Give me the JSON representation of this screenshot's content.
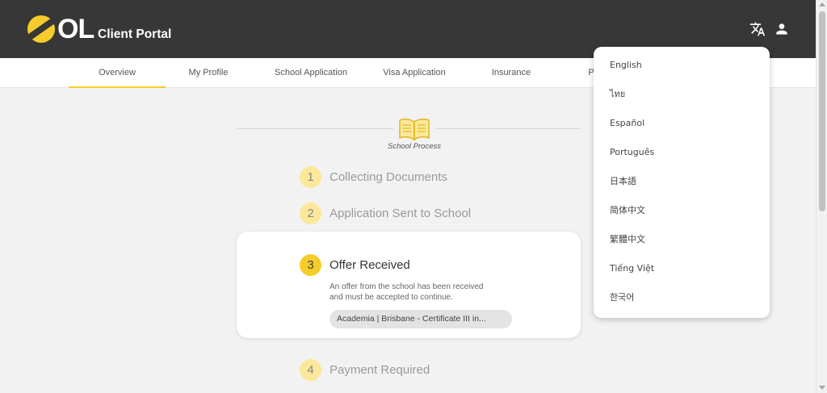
{
  "brand": {
    "logo_text": "OL",
    "portal_title": "Client Portal",
    "accent": "#f5cc2a",
    "header_bg": "#373737"
  },
  "header_icons": [
    "translate-icon",
    "account-icon"
  ],
  "nav": {
    "tabs": [
      {
        "label": "Overview",
        "active": true
      },
      {
        "label": "My Profile",
        "active": false
      },
      {
        "label": "School Application",
        "active": false
      },
      {
        "label": "Visa Application",
        "active": false
      },
      {
        "label": "Insurance",
        "active": false
      },
      {
        "label": "P",
        "active": false
      }
    ]
  },
  "process": {
    "label": "School Process",
    "steps": [
      {
        "num": "1",
        "label": "Collecting Documents"
      },
      {
        "num": "2",
        "label": "Application Sent to School"
      },
      {
        "num": "3",
        "label": "Offer Received"
      },
      {
        "num": "4",
        "label": "Payment Required"
      }
    ],
    "active_step": {
      "description_line1": "An offer from the school has been received",
      "description_line2": "and must be accepted to continue.",
      "chip": "Academia | Brisbane - Certificate III in..."
    }
  },
  "language_menu": {
    "items": [
      "English",
      "ไทย",
      "Español",
      "Português",
      "日本語",
      "简体中文",
      "繁體中文",
      "Tiếng Việt",
      "한국어"
    ]
  }
}
